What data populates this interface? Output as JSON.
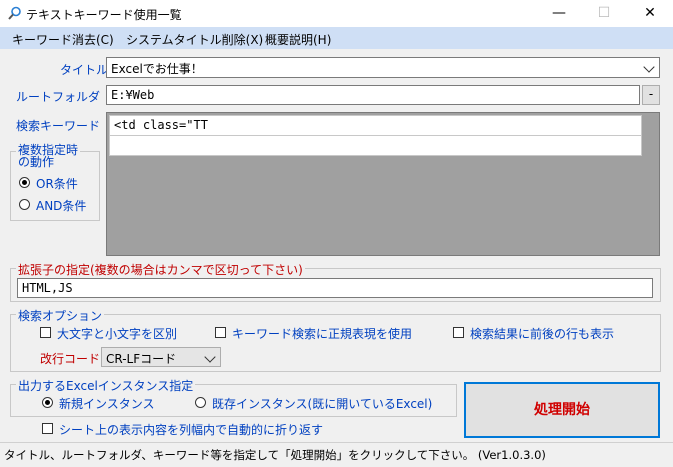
{
  "window": {
    "title": "テキストキーワード使用一覧",
    "minimize": "—",
    "maximize": "☐",
    "close": "✕"
  },
  "menu": [
    {
      "label": "キーワード消去(C)"
    },
    {
      "label": "システムタイトル削除(X)"
    },
    {
      "label": "概要説明(H)"
    }
  ],
  "title_field": {
    "label": "タイトル",
    "value": "Excelでお仕事！"
  },
  "root_folder": {
    "label": "ルートフォルダ",
    "value": "E:¥Web",
    "button": "-"
  },
  "keywords": {
    "label": "検索キーワード",
    "rows": [
      "<td class=\"TT",
      ""
    ]
  },
  "multi_mode": {
    "legend": "複数指定時\nの動作",
    "options": [
      {
        "label": "OR条件",
        "selected": true
      },
      {
        "label": "AND条件",
        "selected": false
      }
    ]
  },
  "extensions": {
    "legend": "拡張子の指定(複数の場合はカンマで区切って下さい)",
    "value": "HTML,JS"
  },
  "search_options": {
    "legend": "検索オプション",
    "case_label": "大文字と小文字を区別",
    "regex_label": "キーワード検索に正規表現を使用",
    "context_label": "検索結果に前後の行も表示",
    "newline_label": "改行コード",
    "newline_value": "CR-LFコード"
  },
  "excel_instance": {
    "legend": "出力するExcelインスタンス指定",
    "new_label": "新規インスタンス",
    "existing_label": "既存インスタンス(既に開いているExcel)",
    "wrap_label": "シート上の表示内容を列幅内で自動的に折り返す"
  },
  "start_button": "処理開始",
  "status": "タイトル、ルートフォルダ、キーワード等を指定して「処理開始」をクリックして下さい。 (Ver1.0.3.0)"
}
